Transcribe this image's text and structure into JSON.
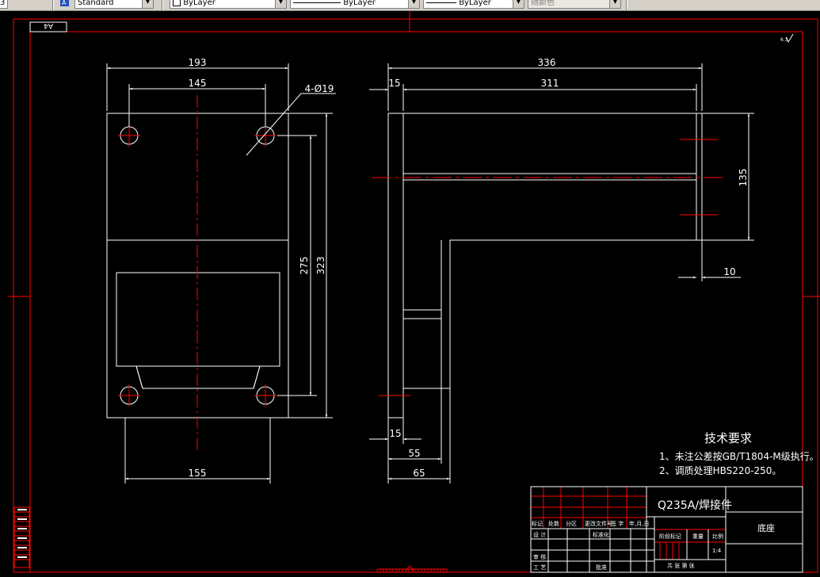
{
  "toolbar": {
    "textstyle_value": "Standard",
    "layer_value": "ByLayer",
    "linetype_value": "ByLayer",
    "lineweight_value": "ByLayer",
    "plotstyle_value": "随颜色"
  },
  "drawing": {
    "corner_label": "A4",
    "roughness_mark": "6.3",
    "front_view": {
      "dim_width_overall": "193",
      "dim_hole_spacing": "145",
      "dim_hole_note": "4-Ø19",
      "dim_height_holes": "275",
      "dim_height_overall": "323",
      "dim_bottom_width": "155"
    },
    "side_view": {
      "dim_length_overall": "336",
      "dim_flange": "15",
      "dim_length_inner": "311",
      "dim_height_top": "135",
      "dim_thickness": "10",
      "dim_base_15": "15",
      "dim_base_55": "55",
      "dim_base_65": "65"
    },
    "tech_req": {
      "title": "技术要求",
      "item1": "1、未注公差按GB/T1804-M级执行。",
      "item2": "2、调质处理HBS220-250。"
    },
    "title_block": {
      "material": "Q235A/焊接件",
      "part_name": "底座",
      "hdr_mark": "标记",
      "hdr_count": "处数",
      "hdr_zone": "分区",
      "hdr_docno": "更改文件号",
      "hdr_sign": "签 字",
      "hdr_date": "年,月,日",
      "row_design": "设 计",
      "row_standard": "标准化",
      "row_review": "审 核",
      "row_process": "工 艺",
      "row_approve": "批准",
      "stage_label": "阶段标记",
      "weight_label": "重量",
      "scale_label": "比例",
      "scale_value": "1:4",
      "sheet_label": "共  张  第  张"
    }
  }
}
